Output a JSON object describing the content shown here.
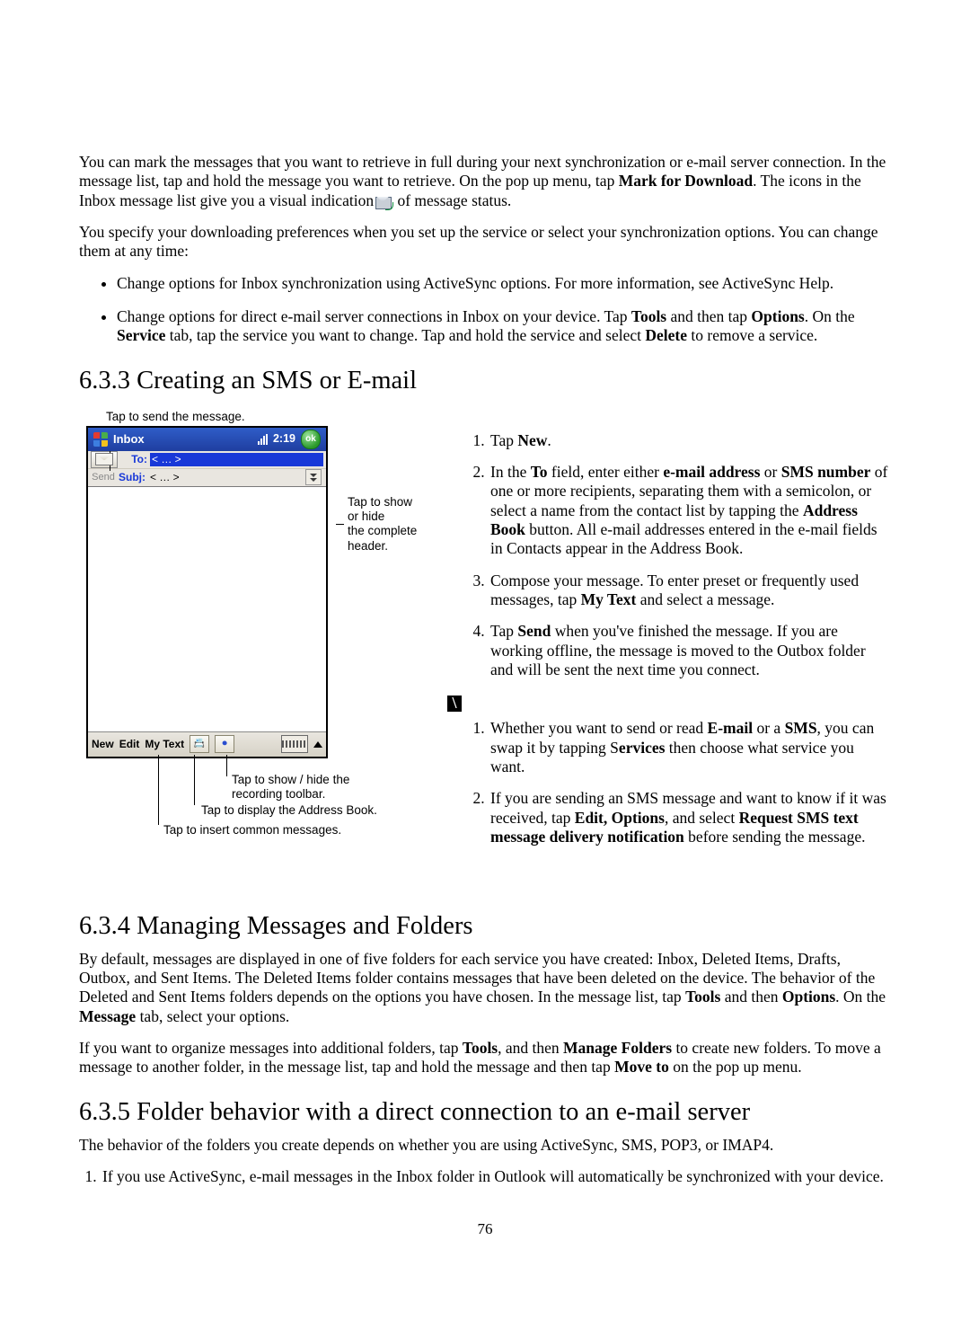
{
  "intro": {
    "p1a": "You can mark the messages that you want to retrieve in full during your next synchronization or e-mail server connection. In the message list, tap and hold the message you want to retrieve. On the pop up menu, tap ",
    "p1b": "Mark for Download",
    "p1c": ". The icons in the Inbox message list give you a visual indication",
    "p1d": " of message status.",
    "p2": "You specify your downloading preferences when you set up the service or select your synchronization options. You can change them at any time:",
    "b1": "Change options for Inbox synchronization using ActiveSync options. For more information, see ActiveSync Help.",
    "b2a": "Change options for direct e-mail server connections in Inbox on your device. Tap ",
    "b2b": "Tools",
    "b2c": " and then tap ",
    "b2d": "Options",
    "b2e": ". On the ",
    "b2f": "Service",
    "b2g": " tab, tap the service you want to change. Tap and hold the service and select ",
    "b2h": "Delete",
    "b2i": " to remove a service."
  },
  "s633": {
    "heading": "6.3.3 Creating an SMS or E-mail",
    "annot": {
      "top": "Tap to send the message.",
      "right1": "Tap to show or hide",
      "right2": "the complete header.",
      "u1a": "Tap to show / hide the",
      "u1b": "recording toolbar.",
      "u2": "Tap to display the Address Book.",
      "u3": "Tap to insert common messages."
    },
    "device": {
      "title": "Inbox",
      "clock": "2:19",
      "ok": "ok",
      "to_label": "To:",
      "subj_label": "Subj:",
      "send_label": "Send",
      "to_value": "< … >",
      "subj_value": "< … >",
      "menu_new": "New",
      "menu_edit": "Edit",
      "menu_mytext": "My Text"
    },
    "steps": {
      "s1a": "Tap ",
      "s1b": "New",
      "s1c": ".",
      "s2a": "In the ",
      "s2b": "To",
      "s2c": " field, enter either ",
      "s2d": "e-mail address",
      "s2e": " or ",
      "s2f": "SMS number",
      "s2g": " of one or more recipients, separating them with a semicolon, or select a name from the contact list by tapping the ",
      "s2h": "Address Book",
      "s2i": " button. All e-mail addresses entered in the e-mail fields in Contacts appear in the Address Book.",
      "s3a": "Compose your message. To enter preset or frequently used messages, tap ",
      "s3b": "My Text",
      "s3c": " and select a message.",
      "s4a": "Tap ",
      "s4b": "Send",
      "s4c": " when you've finished the message. If you are working offline, the message is moved to the Outbox folder and will be sent the next time you connect."
    },
    "notes": {
      "mark": "\\",
      "n1a": "Whether you want to send or read ",
      "n1b": "E-mail",
      "n1c": " or a ",
      "n1d": "SMS",
      "n1e": ", you can swap it by tapping S",
      "n1f": "ervices",
      "n1g": " then choose what service you want.",
      "n2a": "If you are sending an SMS message and want to know if it was received, tap ",
      "n2b": "Edit, Options",
      "n2c": ", and select ",
      "n2d": "Request SMS text message delivery notification",
      "n2e": " before sending the message."
    }
  },
  "s634": {
    "heading": "6.3.4 Managing Messages and Folders",
    "p1a": "By default, messages are displayed in one of five folders for each service you have created: Inbox, Deleted Items, Drafts, Outbox, and Sent Items. The Deleted Items folder contains messages that have been deleted on the device. The behavior of the Deleted and Sent Items folders depends on the options you have chosen. In the message list, tap ",
    "p1b": "Tools",
    "p1c": " and then ",
    "p1d": "Options",
    "p1e": ". On the ",
    "p1f": "Message",
    "p1g": " tab, select your options.",
    "p2a": "If you want to organize messages into additional folders, tap ",
    "p2b": "Tools",
    "p2c": ", and then ",
    "p2d": "Manage Folders",
    "p2e": " to create new folders. To move a message to another folder, in the message list, tap and hold the message and then tap ",
    "p2f": "Move to",
    "p2g": " on the pop up menu."
  },
  "s635": {
    "heading": "6.3.5 Folder behavior with a direct connection to an e-mail server",
    "p1": "The behavior of the folders you create depends on whether you are using ActiveSync, SMS, POP3, or IMAP4.",
    "li1": "If you use ActiveSync, e-mail messages in the Inbox folder in Outlook will automatically be synchronized with your device."
  },
  "page_number": "76"
}
